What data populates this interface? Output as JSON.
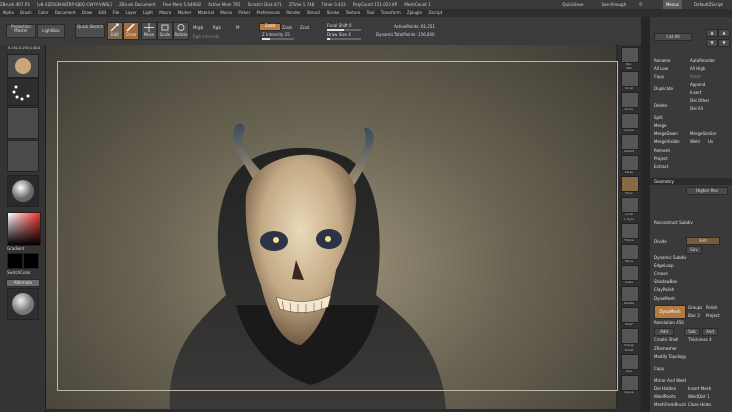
{
  "titlebar": {
    "items": [
      "ZBrush 4R7 P3",
      "[v8.4]ZOGN-WZRP-SJBQ-CWYY-VWSL]",
      "ZBrush Document",
      "Free Mem 5.649GB",
      "Active Mem 765",
      "Scratch Disk 871",
      "ZTime 1.748",
      "Timer 0.423",
      "PolyCount 151.023 KP",
      "MeshCount 1"
    ],
    "quicksave": "QuickSave",
    "seethrough_label": "See-through",
    "seethrough_value": "0",
    "menus": "Menus",
    "defaultscript": "DefaultZScript"
  },
  "menubar": [
    "Alpha",
    "Brush",
    "Color",
    "Document",
    "Draw",
    "Edit",
    "File",
    "Layer",
    "Light",
    "Macro",
    "Marker",
    "Material",
    "Movie",
    "Picker",
    "Preferences",
    "Render",
    "Stencil",
    "Stroke",
    "Texture",
    "Tool",
    "Transform",
    "Zplugin",
    "Zscript"
  ],
  "toolbar": {
    "projection_master": "Projection Master",
    "lightbox": "LightBox",
    "quick_sketch": "Quick Sketch",
    "edit": "Edit",
    "draw": "Draw",
    "move": "Move",
    "scale": "Scale",
    "rotate": "Rotate",
    "mrgb": "Mrgb",
    "rgb": "Rgb",
    "m": "M",
    "rgb_intensity": "Rgb Intensity",
    "zadd": "Zadd",
    "zsub": "Zsub",
    "zcut": "Zcut",
    "z_intensity_label": "Z Intensity",
    "z_intensity_value": "25",
    "focal_shift_label": "Focal Shift",
    "focal_shift_value": "0",
    "draw_size_label": "Draw Size",
    "draw_size_value": "4",
    "dynamic": "Dynamic",
    "active_points": "ActivePoints: 61,251",
    "total_points": "TotalPoints: 156,040",
    "coords": "0.151,0.253,0.814"
  },
  "lefttray": {
    "gradient": "Gradient",
    "switch_color": "SwitchColor",
    "alternate": "Alternate"
  },
  "righttray": [
    "Bpr",
    "SPix",
    "Scroll",
    "Zoom",
    "Actual",
    "AAHalf",
    "Persp",
    "Floor",
    "Local",
    "L.Sym",
    "Frame",
    "Move",
    "Scale",
    "Rotate",
    "PolyF",
    "Transp",
    "Ghost",
    "Solo",
    "Xpose"
  ],
  "panel": {
    "list_all": "List All",
    "rename": "Rename",
    "autoreorder": "AutoReorder",
    "all_low": "All Low",
    "all_high": "All High",
    "copy": "Copy",
    "paste": "Paste",
    "append": "Append",
    "duplicate": "Duplicate",
    "insert": "Insert",
    "del_other": "Del Other",
    "delete": "Delete",
    "del_all": "Del All",
    "split": "Split",
    "merge": "Merge",
    "mergedown": "MergeDown",
    "mergesimilar": "MergeSimilar",
    "mergevisible": "MergeVisible",
    "weld": "Weld",
    "uv": "Uv",
    "remesh": "Remesh",
    "project": "Project",
    "extract": "Extract",
    "geometry": "Geometry",
    "higher_res": "Higher Res",
    "reconstruct_subdiv": "Reconstruct Subdiv",
    "divide": "Divide",
    "smt": "Smt",
    "suv": "Suv",
    "dynamic_subdiv": "Dynamic Subdiv",
    "edgeloop": "EdgeLoop",
    "crease": "Crease",
    "shadowbox": "ShadowBox",
    "claypolish": "ClayPolish",
    "dynamesh_head": "DynaMesh",
    "dynamesh_btn": "DynaMesh",
    "groups": "Groups",
    "polish": "Polish",
    "blur": "Blur",
    "blur_value": "2",
    "project_btn": "Project",
    "resolution_label": "Resolution",
    "resolution_value": "456",
    "add": "Add",
    "sub": "Sub",
    "and": "And",
    "create_shell": "Create Shell",
    "thickness_label": "Thickness",
    "thickness_value": "4",
    "zremesher": "ZRemesher",
    "modify_topology": "Modify Topology",
    "copy2": "Copy",
    "mirror_and_weld": "Mirror And Weld",
    "del_hidden": "Del Hidden",
    "insert_mesh": "Insert Mesh",
    "weld_points": "WeldPoints",
    "weld_dist_label": "WeldDist",
    "weld_dist_value": "1",
    "mesh_from_brush": "MeshFromBrush",
    "close_holes": "Close Holes"
  },
  "colors": {
    "accent": "#e8a868",
    "canvas_center": "#9a9178",
    "canvas_edge": "#3d3a33"
  }
}
